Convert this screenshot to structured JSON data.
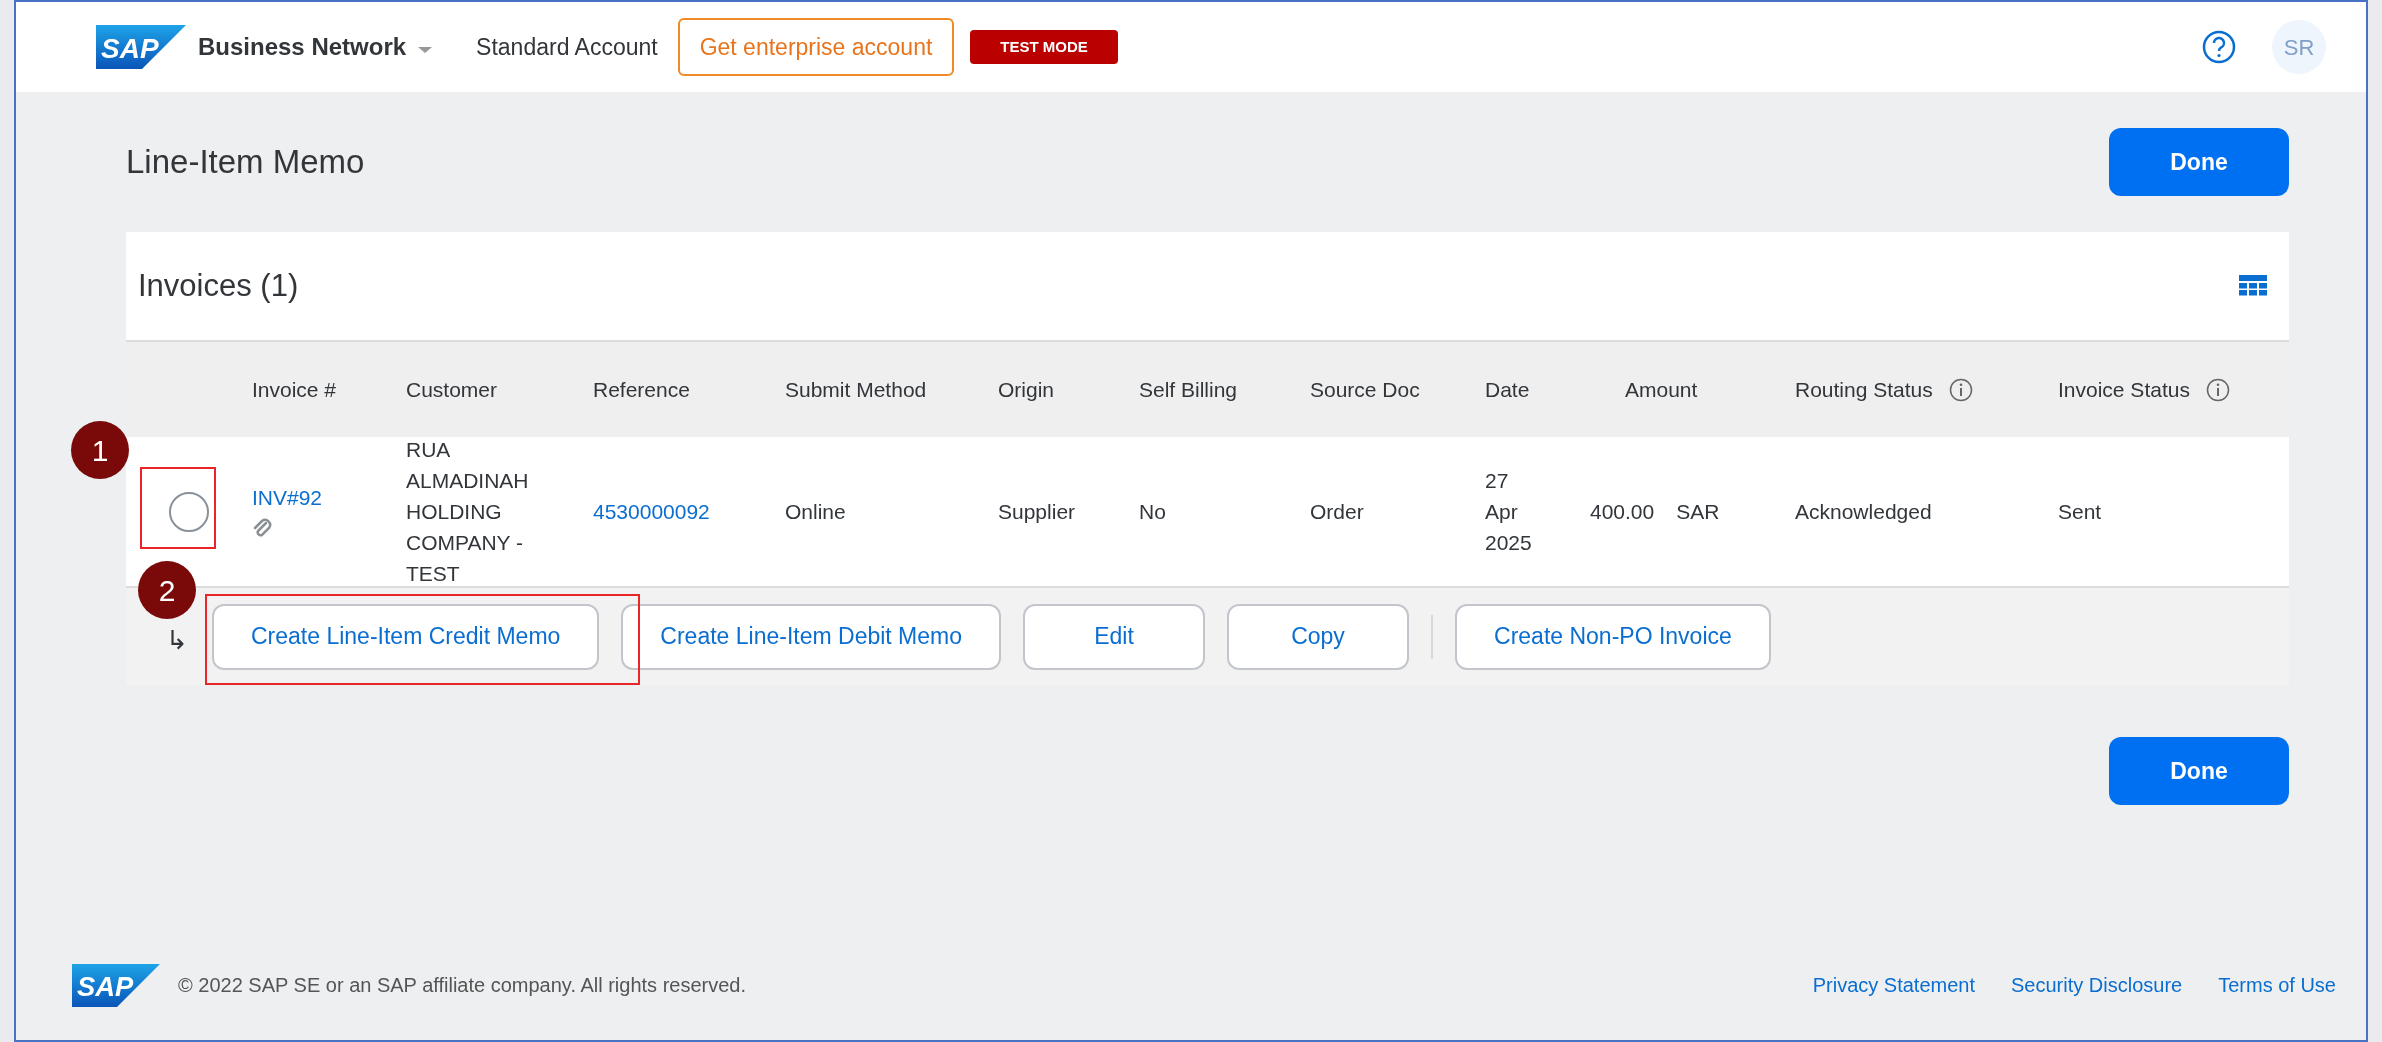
{
  "header": {
    "logo": "SAP",
    "brand": "Business Network",
    "account": "Standard Account",
    "upgrade_button": "Get enterprise account",
    "mode_badge": "TEST MODE",
    "avatar": "SR"
  },
  "page": {
    "title": "Line-Item Memo",
    "done_top": "Done",
    "done_bottom": "Done"
  },
  "invoices": {
    "title": "Invoices (1)",
    "columns": [
      {
        "label": "Invoice #",
        "info": false
      },
      {
        "label": "Customer",
        "info": false
      },
      {
        "label": "Reference",
        "info": false
      },
      {
        "label": "Submit Method",
        "info": false
      },
      {
        "label": "Origin",
        "info": false
      },
      {
        "label": "Self Billing",
        "info": false
      },
      {
        "label": "Source Doc",
        "info": false
      },
      {
        "label": "Date",
        "info": false
      },
      {
        "label": "Amount",
        "info": false
      },
      {
        "label": "Routing Status",
        "info": true
      },
      {
        "label": "Invoice Status",
        "info": true
      }
    ],
    "rows": [
      {
        "selected": false,
        "invoice": "INV#92",
        "attachment": true,
        "customer": "RUA ALMADINAH HOLDING COMPANY - TEST",
        "reference": "4530000092",
        "submit_method": "Online",
        "origin": "Supplier",
        "self_billing": "No",
        "source_doc": "Order",
        "date": "27 Apr 2025",
        "amount": "400.00",
        "currency": "SAR",
        "routing_status": "Acknowledged",
        "invoice_status": "Sent"
      }
    ],
    "actions_arrow": "↳",
    "actions": [
      {
        "kind": "button",
        "label": "Create Line-Item Credit Memo"
      },
      {
        "kind": "button",
        "label": "Create Line-Item Debit Memo"
      },
      {
        "kind": "button",
        "label": "Edit"
      },
      {
        "kind": "button",
        "label": "Copy"
      },
      {
        "kind": "separator"
      },
      {
        "kind": "button",
        "label": "Create Non-PO Invoice"
      }
    ]
  },
  "annotations": [
    {
      "label": "1"
    },
    {
      "label": "2"
    }
  ],
  "footer": {
    "logo": "SAP",
    "copyright": "© 2022 SAP SE or an SAP affiliate company. All rights reserved.",
    "links": [
      "Privacy Statement",
      "Security Disclosure",
      "Terms of Use"
    ]
  }
}
